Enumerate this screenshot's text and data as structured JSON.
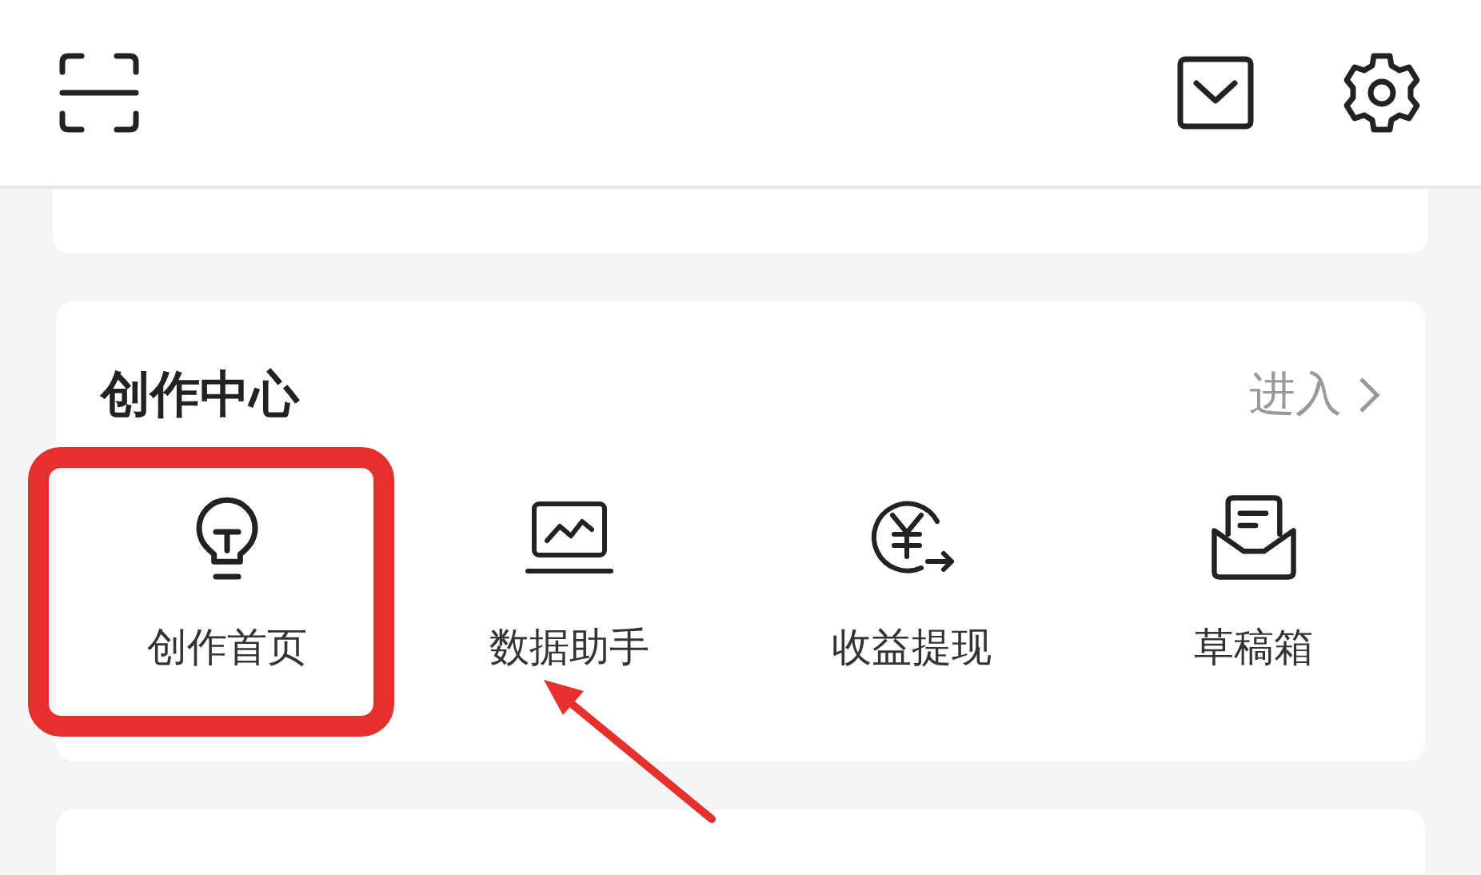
{
  "section": {
    "title": "创作中心",
    "link": "进入"
  },
  "items": [
    {
      "label": "创作首页",
      "kind": "bulb"
    },
    {
      "label": "数据助手",
      "kind": "chart"
    },
    {
      "label": "收益提现",
      "kind": "money"
    },
    {
      "label": "草稿箱",
      "kind": "drafts"
    }
  ]
}
